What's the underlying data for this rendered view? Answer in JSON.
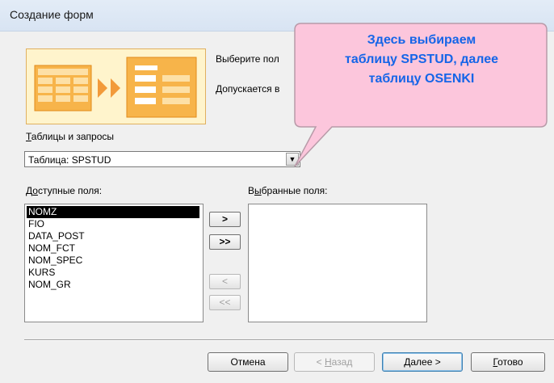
{
  "window": {
    "title": "Создание форм"
  },
  "instructions": {
    "line1": "Выберите пол",
    "line2": "Допускается в"
  },
  "tables": {
    "label_underline": "Т",
    "label_rest": "аблицы и запросы",
    "selected": "Таблица: SPSTUD"
  },
  "available": {
    "label_prefix": "Д",
    "label_underline": "о",
    "label_rest": "ступные поля:",
    "items": [
      "NOMZ",
      "FIO",
      "DATA_POST",
      "NOM_FCT",
      "NOM_SPEC",
      "KURS",
      "NOM_GR"
    ],
    "selected_index": 0
  },
  "selected_fields": {
    "label_prefix": "В",
    "label_underline": "ы",
    "label_rest": "бранные поля:",
    "items": []
  },
  "move_buttons": {
    "add_one": ">",
    "add_all": ">>",
    "remove_one": "<",
    "remove_all": "<<"
  },
  "footer": {
    "cancel": "Отмена",
    "back_prefix": "< ",
    "back_underline": "Н",
    "back_rest": "азад",
    "next_underline": "Д",
    "next_rest": "алее >",
    "finish_underline": "Г",
    "finish_rest": "отово"
  },
  "callout": {
    "line1": "Здесь выбираем",
    "line2": "таблицу SPSTUD, далее",
    "line3": "таблицу OSENKI"
  },
  "colors": {
    "callout_fill": "#fcc6dc",
    "callout_border": "#b89aa8",
    "callout_text": "#1565e8",
    "selection": "#000000"
  }
}
